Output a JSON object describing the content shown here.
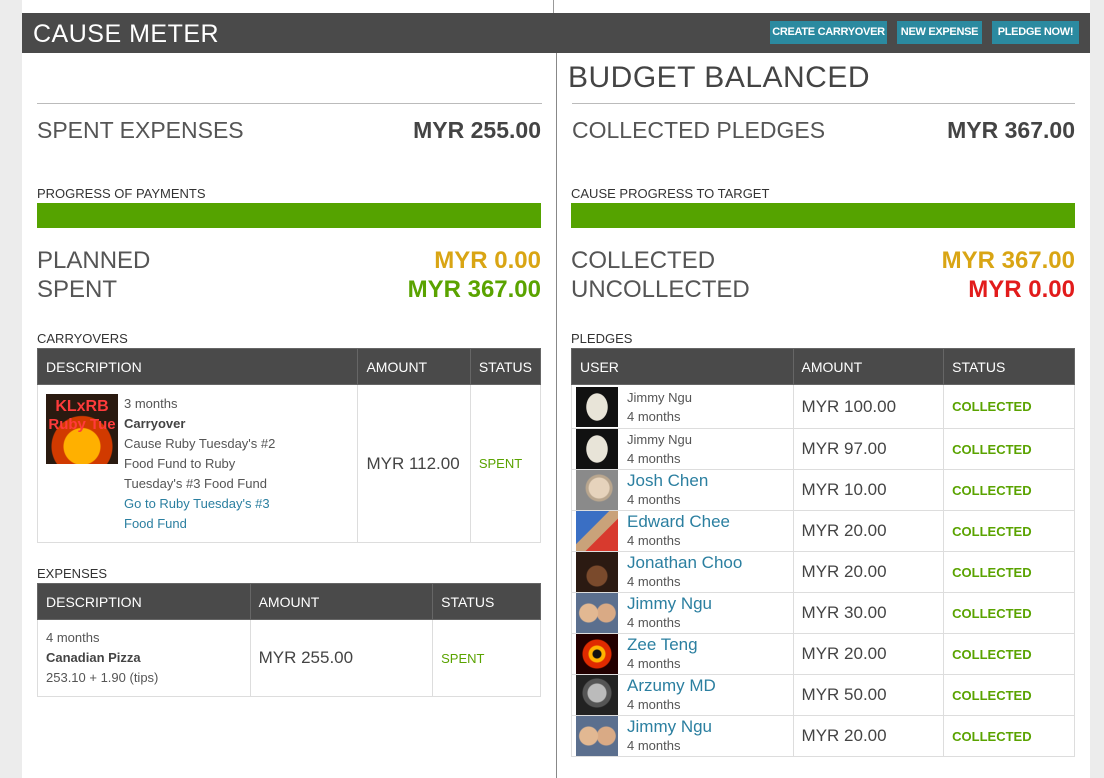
{
  "header": {
    "title": "CAUSE METER",
    "buttons": {
      "create_carryover": "CREATE CARRYOVER",
      "new_expense": "NEW EXPENSE",
      "pledge_now": "PLEDGE NOW!"
    }
  },
  "budget_status": "BUDGET BALANCED",
  "left": {
    "spent_label": "SPENT EXPENSES",
    "spent_value": "MYR 255.00",
    "progress_label": "PROGRESS OF PAYMENTS",
    "progress_fraction": 1.0,
    "planned_label": "PLANNED",
    "planned_value": "MYR 0.00",
    "spent2_label": "SPENT",
    "spent2_value": "MYR 367.00",
    "carryovers_label": "CARRYOVERS",
    "carry_headers": [
      "DESCRIPTION",
      "AMOUNT",
      "STATUS"
    ],
    "carryover": {
      "thumb_text_1": "KLxRB",
      "thumb_text_2": "Ruby Tue",
      "ago": "3 months",
      "title": "Carryover",
      "desc": "Cause Ruby Tuesday's #2 Food Fund to Ruby Tuesday's #3 Food Fund",
      "link": "Go to Ruby Tuesday's #3 Food Fund",
      "amount": "MYR 112.00",
      "status": "SPENT"
    },
    "expenses_label": "EXPENSES",
    "exp_headers": [
      "DESCRIPTION",
      "AMOUNT",
      "STATUS"
    ],
    "expense": {
      "ago": "4 months",
      "title": "Canadian Pizza",
      "detail": "253.10 + 1.90 (tips)",
      "amount": "MYR 255.00",
      "status": "SPENT"
    }
  },
  "right": {
    "collected_label": "COLLECTED PLEDGES",
    "collected_value": "MYR 367.00",
    "progress_label": "CAUSE PROGRESS TO TARGET",
    "progress_fraction": 1.0,
    "collected2_label": "COLLECTED",
    "collected2_value": "MYR 367.00",
    "uncollected_label": "UNCOLLECTED",
    "uncollected_value": "MYR 0.00",
    "pledges_label": "PLEDGES",
    "pledge_headers": [
      "USER",
      "AMOUNT",
      "STATUS"
    ],
    "pledges": [
      {
        "user": "Jimmy Ngu",
        "ago": "4 months",
        "amount": "MYR 100.00",
        "status": "COLLECTED",
        "plain": true,
        "avatar": "mask"
      },
      {
        "user": "Jimmy Ngu",
        "ago": "4 months",
        "amount": "MYR 97.00",
        "status": "COLLECTED",
        "plain": true,
        "avatar": "mask"
      },
      {
        "user": "Josh Chen",
        "ago": "4 months",
        "amount": "MYR 10.00",
        "status": "COLLECTED",
        "plain": false,
        "avatar": "grey"
      },
      {
        "user": "Edward Chee",
        "ago": "4 months",
        "amount": "MYR 20.00",
        "status": "COLLECTED",
        "plain": false,
        "avatar": "blue"
      },
      {
        "user": "Jonathan Choo",
        "ago": "4 months",
        "amount": "MYR 20.00",
        "status": "COLLECTED",
        "plain": false,
        "avatar": "dark"
      },
      {
        "user": "Jimmy Ngu",
        "ago": "4 months",
        "amount": "MYR 30.00",
        "status": "COLLECTED",
        "plain": false,
        "avatar": "duo"
      },
      {
        "user": "Zee Teng",
        "ago": "4 months",
        "amount": "MYR 20.00",
        "status": "COLLECTED",
        "plain": false,
        "avatar": "eye"
      },
      {
        "user": "Arzumy MD",
        "ago": "4 months",
        "amount": "MYR 50.00",
        "status": "COLLECTED",
        "plain": false,
        "avatar": "bw"
      },
      {
        "user": "Jimmy Ngu",
        "ago": "4 months",
        "amount": "MYR 20.00",
        "status": "COLLECTED",
        "plain": false,
        "avatar": "duo"
      }
    ]
  },
  "colors": {
    "header_bg": "#4a4a4a",
    "button_bg": "#2b8aa0",
    "progress_green": "#55a300",
    "planned_gold": "#d9a514",
    "spent_green": "#5aa300",
    "uncollected_red": "#e21b1b",
    "link_blue": "#2b7fa0"
  }
}
